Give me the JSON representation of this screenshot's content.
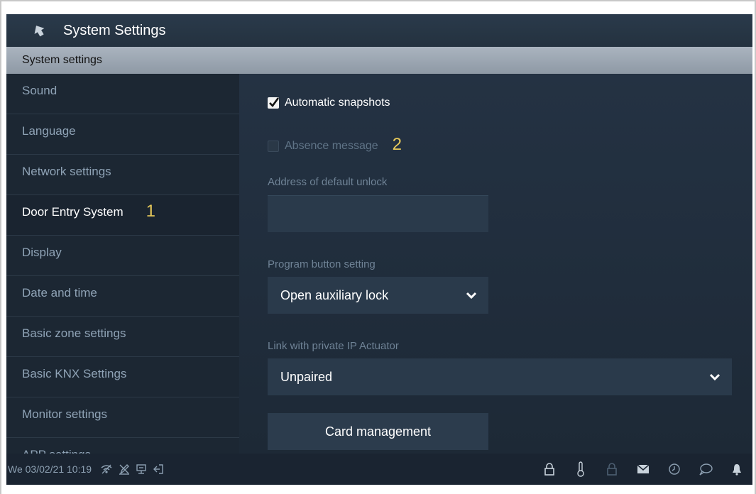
{
  "header": {
    "title": "System Settings",
    "back_icon": "back-arrow-icon"
  },
  "subheader": {
    "title": "System settings"
  },
  "sidebar": {
    "items": [
      {
        "label": "Sound"
      },
      {
        "label": "Language"
      },
      {
        "label": "Network settings"
      },
      {
        "label": "Door Entry System",
        "active": true,
        "callout": "1"
      },
      {
        "label": "Display"
      },
      {
        "label": "Date and time"
      },
      {
        "label": "Basic zone settings"
      },
      {
        "label": "Basic KNX Settings"
      },
      {
        "label": "Monitor settings"
      },
      {
        "label": "APP settings"
      }
    ]
  },
  "main": {
    "automatic_snapshots": {
      "label": "Automatic snapshots",
      "checked": true
    },
    "absence_message": {
      "label": "Absence message",
      "checked": false,
      "callout": "2"
    },
    "default_unlock": {
      "label": "Address of default unlock",
      "value": ""
    },
    "program_button": {
      "label": "Program button setting",
      "value": "Open auxiliary lock"
    },
    "ip_actuator": {
      "label": "Link with private IP Actuator",
      "value": "Unpaired"
    },
    "card_management": {
      "label": "Card management"
    }
  },
  "statusbar": {
    "datetime": "We 03/02/21  10:19",
    "left_icons": [
      "wifi-icon",
      "no-write-icon",
      "network-icon",
      "logout-icon"
    ],
    "right_icons": [
      "lock-icon",
      "thermometer-icon",
      "lock-dim-icon",
      "mail-icon",
      "history-icon",
      "chat-icon",
      "bell-icon"
    ]
  },
  "colors": {
    "background": "#1f2c3b",
    "subheader": "#9aa5b1",
    "callout": "#e7c95a",
    "text_muted": "#8fa3b6",
    "text_active": "#ffffff"
  }
}
